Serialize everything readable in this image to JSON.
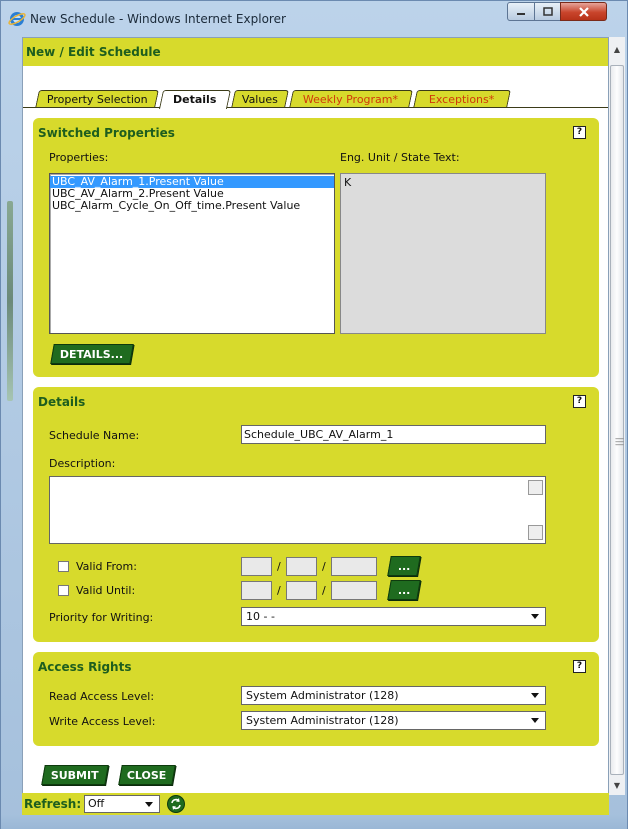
{
  "window": {
    "title": "New Schedule - Windows Internet Explorer"
  },
  "page": {
    "title": "New / Edit Schedule"
  },
  "tabs": [
    {
      "label": "Property Selection",
      "active": false,
      "modified": false
    },
    {
      "label": "Details",
      "active": true,
      "modified": false
    },
    {
      "label": "Values",
      "active": false,
      "modified": false
    },
    {
      "label": "Weekly Program*",
      "active": false,
      "modified": true
    },
    {
      "label": "Exceptions*",
      "active": false,
      "modified": true
    }
  ],
  "switched_properties": {
    "heading": "Switched Properties",
    "help": "?",
    "properties_label": "Properties:",
    "unit_label": "Eng. Unit / State Text:",
    "items": [
      "UBC_AV_Alarm_1.Present Value",
      "UBC_AV_Alarm_2.Present Value",
      "UBC_Alarm_Cycle_On_Off_time.Present Value"
    ],
    "selected_index": 0,
    "unit_value": "K",
    "details_button": "DETAILS..."
  },
  "details": {
    "heading": "Details",
    "help": "?",
    "schedule_name_label": "Schedule Name:",
    "schedule_name_value": "Schedule_UBC_AV_Alarm_1",
    "description_label": "Description:",
    "description_value": "",
    "valid_from_label": "Valid From:",
    "valid_until_label": "Valid Until:",
    "date_sep": "/",
    "date_button": "...",
    "priority_label": "Priority for Writing:",
    "priority_value": "10 - -"
  },
  "access_rights": {
    "heading": "Access Rights",
    "help": "?",
    "read_label": "Read Access Level:",
    "read_value": "System Administrator (128)",
    "write_label": "Write Access Level:",
    "write_value": "System Administrator (128)"
  },
  "actions": {
    "submit": "SUBMIT",
    "close": "CLOSE"
  },
  "refresh": {
    "label": "Refresh:",
    "value": "Off"
  },
  "colors": {
    "panel": "#d7da2c",
    "heading_green": "#1e5e1e",
    "button_green": "#1f6b1f",
    "modified_tab_text": "#d03a0a",
    "selection": "#3399ff"
  }
}
